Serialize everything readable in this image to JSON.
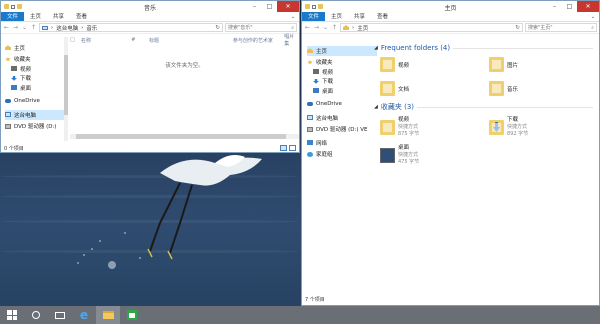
{
  "left_window": {
    "title": "音乐",
    "ribbon_tabs": [
      "文件",
      "主页",
      "共享",
      "查看"
    ],
    "address_path": [
      "这台电脑",
      "音乐"
    ],
    "search_placeholder": "搜索\"音乐\"",
    "columns": [
      "名称",
      "#",
      "标题",
      "参与创作的艺术家",
      "唱片集"
    ],
    "empty_message": "该文件夹为空。",
    "status_text": "0 个项目",
    "nav": [
      {
        "label": "主页",
        "icon": "home-icon"
      },
      {
        "label": "收藏夹",
        "icon": "star-icon"
      },
      {
        "label": "视频",
        "icon": "video-icon"
      },
      {
        "label": "下载",
        "icon": "download-icon"
      },
      {
        "label": "桌面",
        "icon": "desktop-icon"
      },
      {
        "label": "OneDrive",
        "icon": "onedrive-icon"
      },
      {
        "label": "这台电脑",
        "icon": "pc-icon"
      },
      {
        "label": "DVD 驱动器 (D:)",
        "icon": "dvd-icon"
      }
    ]
  },
  "right_window": {
    "title": "主页",
    "ribbon_tabs": [
      "文件",
      "主页",
      "共享",
      "查看"
    ],
    "address_path": [
      "主页"
    ],
    "search_placeholder": "搜索\"主页\"",
    "status_text": "7 个项目",
    "nav": [
      {
        "label": "主页",
        "icon": "home-icon"
      },
      {
        "label": "收藏夹",
        "icon": "star-icon"
      },
      {
        "label": "视频",
        "icon": "video-icon"
      },
      {
        "label": "下载",
        "icon": "download-icon"
      },
      {
        "label": "桌面",
        "icon": "desktop-icon"
      },
      {
        "label": "OneDrive",
        "icon": "onedrive-icon"
      },
      {
        "label": "这台电脑",
        "icon": "pc-icon"
      },
      {
        "label": "DVD 驱动器 (D:) VE",
        "icon": "dvd-icon"
      },
      {
        "label": "网络",
        "icon": "network-icon"
      },
      {
        "label": "家庭组",
        "icon": "homegroup-icon"
      }
    ],
    "frequent_header": "Frequent folders (4)",
    "frequent": [
      {
        "name": "视频",
        "icon": "folder-icon"
      },
      {
        "name": "图片",
        "icon": "folder-icon"
      },
      {
        "name": "文档",
        "icon": "folder-icon"
      },
      {
        "name": "音乐",
        "icon": "folder-icon"
      }
    ],
    "favorites_header": "收藏夹 (3)",
    "favorites": [
      {
        "name": "视频",
        "type": "快捷方式",
        "size": "875 字节",
        "icon": "video-shortcut-icon"
      },
      {
        "name": "下载",
        "type": "快捷方式",
        "size": "892 字节",
        "icon": "download-shortcut-icon"
      },
      {
        "name": "桌面",
        "type": "快捷方式",
        "size": "475 字节",
        "icon": "desktop-shortcut-icon"
      }
    ]
  },
  "taskbar": {
    "items": [
      "start-icon",
      "search-icon",
      "task-view-icon",
      "internet-explorer-icon",
      "file-explorer-icon",
      "store-icon"
    ]
  }
}
